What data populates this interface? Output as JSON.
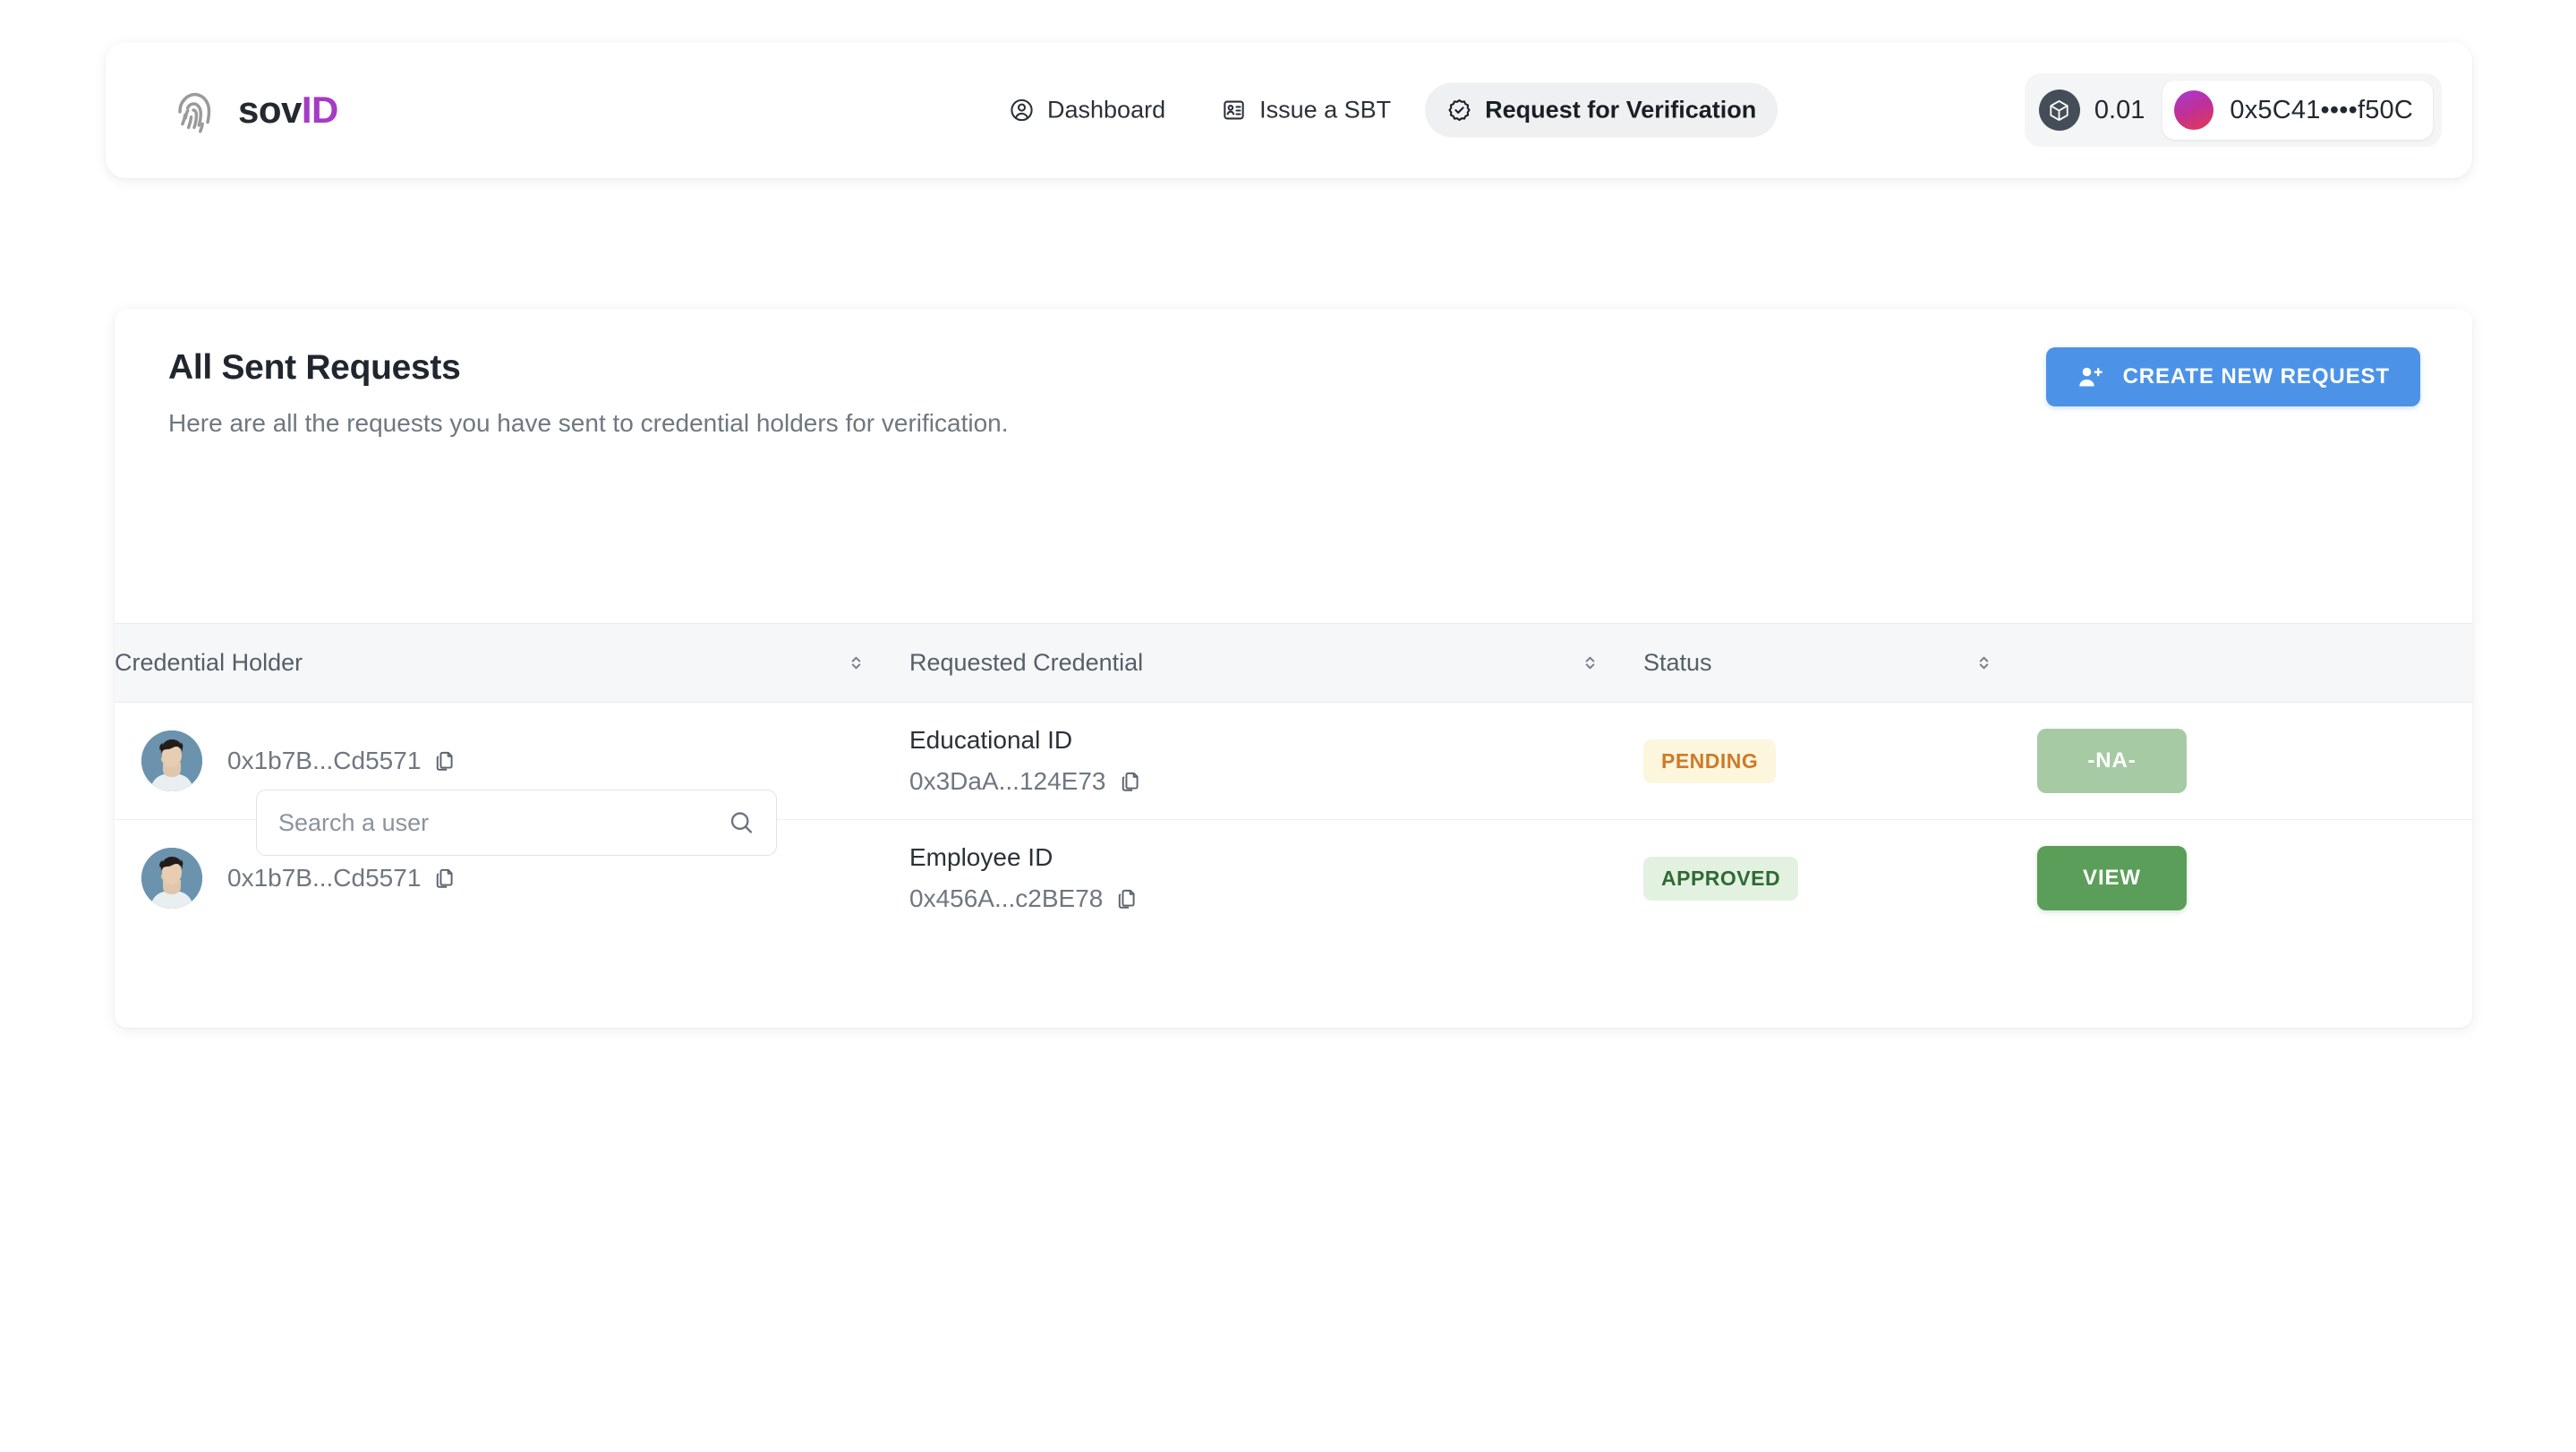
{
  "brand": {
    "name_primary": "sov",
    "name_accent": "ID",
    "accent_color": "#a63bc4"
  },
  "nav": {
    "items": [
      {
        "label": "Dashboard",
        "icon": "user-circle-icon",
        "active": false
      },
      {
        "label": "Issue a SBT",
        "icon": "id-card-icon",
        "active": false
      },
      {
        "label": "Request for Verification",
        "icon": "badge-check-icon",
        "active": true
      }
    ]
  },
  "wallet": {
    "balance": "0.01",
    "balance_icon": "cube-icon",
    "address": "0x5C41••••f50C"
  },
  "main": {
    "title": "All Sent Requests",
    "subtitle": "Here are all the requests you have sent to credential holders for verification.",
    "create_button": {
      "label": "CREATE NEW REQUEST",
      "icon": "user-plus-icon",
      "color": "#4c93e8"
    },
    "search": {
      "placeholder": "Search a user",
      "value": "",
      "icon": "search-icon"
    }
  },
  "table": {
    "columns": [
      {
        "label": "Credential Holder",
        "sortable": true
      },
      {
        "label": "Requested Credential",
        "sortable": true
      },
      {
        "label": "Status",
        "sortable": true
      },
      {
        "label": "",
        "sortable": false
      }
    ],
    "rows": [
      {
        "holder_address": "0x1b7B...Cd5571",
        "credential_name": "Educational ID",
        "credential_address": "0x3DaA...124E73",
        "status": "PENDING",
        "status_kind": "pending",
        "action_label": "-NA-",
        "action_kind": "disabled"
      },
      {
        "holder_address": "0x1b7B...Cd5571",
        "credential_name": "Employee ID",
        "credential_address": "0x456A...c2BE78",
        "status": "APPROVED",
        "status_kind": "approved",
        "action_label": "VIEW",
        "action_kind": "view"
      }
    ]
  }
}
